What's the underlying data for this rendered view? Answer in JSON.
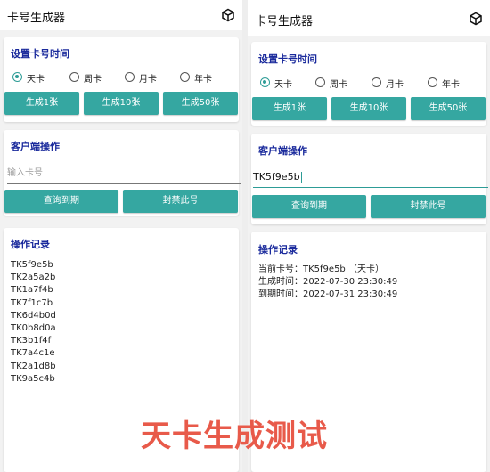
{
  "app": {
    "title": "卡号生成器"
  },
  "settings": {
    "title": "设置卡号时间",
    "options": [
      "天卡",
      "周卡",
      "月卡",
      "年卡"
    ],
    "selected": "天卡",
    "buttons": [
      "生成1张",
      "生成10张",
      "生成50张"
    ]
  },
  "client": {
    "title": "客户端操作",
    "placeholder": "输入卡号",
    "left_value": "",
    "right_value": "TK5f9e5b",
    "buttons": [
      "查询到期",
      "封禁此号"
    ]
  },
  "log": {
    "title": "操作记录",
    "left_lines": [
      "TK5f9e5b",
      "TK2a5a2b",
      "TK1a7f4b",
      "TK7f1c7b",
      "TK6d4b0d",
      "TK0b8d0a",
      "TK3b1f4f",
      "TK7a4c1e",
      "TK2a1d8b",
      "TK9a5c4b"
    ],
    "right_lines": [
      "当前卡号：TK5f9e5b  （天卡）",
      "生成时间：2022-07-30 23:30:49",
      "到期时间：2022-07-31 23:30:49"
    ]
  },
  "overlay": {
    "caption": "天卡生成测试"
  },
  "colors": {
    "accent": "#35a7a1",
    "section_title": "#1a2a9c",
    "caption": "#e85a4a"
  }
}
